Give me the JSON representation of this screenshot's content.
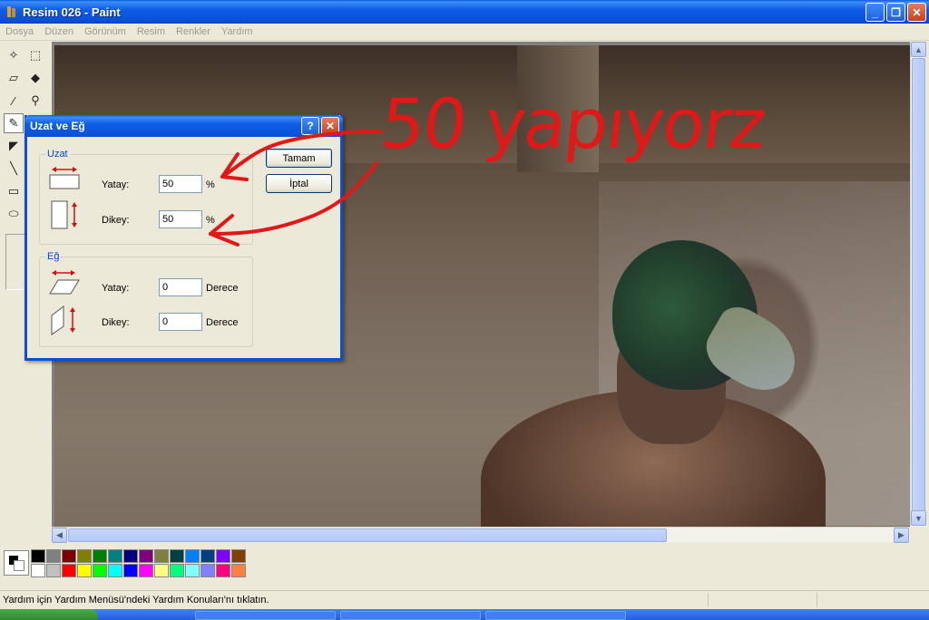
{
  "window": {
    "title": "Resim 026 - Paint",
    "min_icon": "minimize-icon",
    "max_icon": "restore-icon",
    "close_icon": "close-icon"
  },
  "menu": [
    "Dosya",
    "Düzen",
    "Görünüm",
    "Resim",
    "Renkler",
    "Yardım"
  ],
  "dialog": {
    "title": "Uzat ve Eğ",
    "help_label": "?",
    "close_label": "✕",
    "stretch": {
      "legend": "Uzat",
      "horizontal_label": "Yatay:",
      "horizontal_value": "50",
      "horizontal_unit": "%",
      "vertical_label": "Dikey:",
      "vertical_value": "50",
      "vertical_unit": "%"
    },
    "skew": {
      "legend": "Eğ",
      "horizontal_label": "Yatay:",
      "horizontal_value": "0",
      "horizontal_unit": "Derece",
      "vertical_label": "Dikey:",
      "vertical_value": "0",
      "vertical_unit": "Derece"
    },
    "ok_label": "Tamam",
    "cancel_label": "İptal"
  },
  "annotation": {
    "text": "50 yapıyorz",
    "color": "#e01818"
  },
  "status": {
    "text": "Yardım için Yardım Menüsü'ndeki Yardım Konuları'nı tıklatın."
  },
  "palette": {
    "foreground": "#000000",
    "background": "#ffffff",
    "top_row": [
      "#000000",
      "#808080",
      "#800000",
      "#808000",
      "#008000",
      "#008080",
      "#000080",
      "#800080",
      "#808040",
      "#004040",
      "#0080ff",
      "#004080",
      "#8000ff",
      "#804000"
    ],
    "bottom_row": [
      "#ffffff",
      "#c0c0c0",
      "#ff0000",
      "#ffff00",
      "#00ff00",
      "#00ffff",
      "#0000ff",
      "#ff00ff",
      "#ffff80",
      "#00ff80",
      "#80ffff",
      "#8080ff",
      "#ff0080",
      "#ff8040"
    ]
  },
  "tools": [
    "free-select-icon",
    "rect-select-icon",
    "eraser-icon",
    "fill-icon",
    "color-picker-icon",
    "magnifier-icon",
    "pencil-icon",
    "brush-icon",
    "airbrush-icon",
    "text-icon",
    "line-icon",
    "curve-icon",
    "rectangle-icon",
    "polygon-icon",
    "ellipse-icon",
    "rounded-rect-icon"
  ]
}
